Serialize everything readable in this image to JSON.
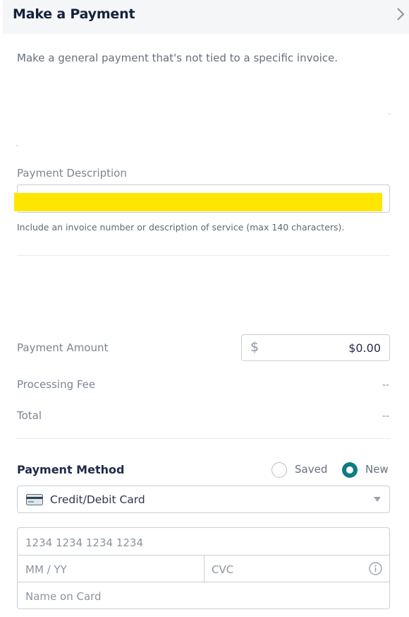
{
  "header": {
    "title": "Make a Payment",
    "chevron_icon": "chevron-right-icon"
  },
  "intro": "Make a general payment that's not tied to a specific invoice.",
  "description": {
    "label": "Payment Description",
    "value": "",
    "helper": "Include an invoice number or description of service (max 140 characters)."
  },
  "amount": {
    "label": "Payment Amount",
    "currency_symbol": "$",
    "value": "$0.00"
  },
  "processing_fee": {
    "label": "Processing Fee",
    "value": "--"
  },
  "total": {
    "label": "Total",
    "value": "--"
  },
  "payment_method": {
    "label": "Payment Method",
    "options": [
      {
        "label": "Saved",
        "selected": false
      },
      {
        "label": "New",
        "selected": true
      }
    ],
    "accent_color": "#0e7c86",
    "type_select": {
      "icon": "credit-card-icon",
      "value": "Credit/Debit Card"
    }
  },
  "card_form": {
    "number_placeholder": "1234 1234 1234 1234",
    "expiry_placeholder": "MM / YY",
    "cvc_placeholder": "CVC",
    "name_placeholder": "Name on Card",
    "cvc_info_icon": "info-icon"
  }
}
